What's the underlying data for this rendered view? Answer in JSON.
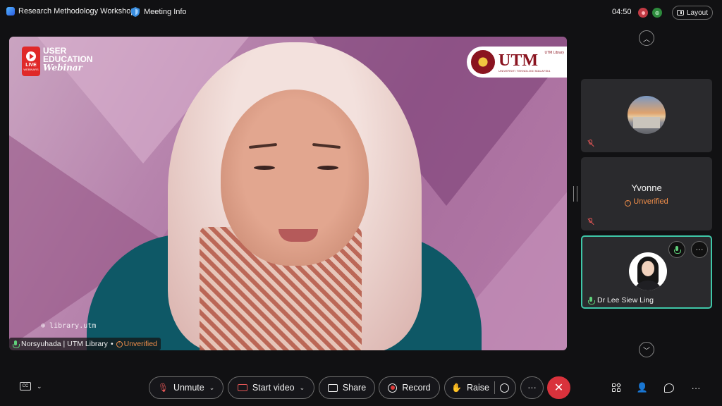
{
  "topbar": {
    "meeting_title": "Research Methodology Workshop",
    "meeting_info_label": "Meeting Info",
    "timer": "04:50",
    "layout_label": "Layout"
  },
  "stage": {
    "webinar_logo": {
      "live": "LIVE",
      "live_sub": "WEBINARS",
      "line1": "USER",
      "line2": "EDUCATION",
      "line3": "Webinar"
    },
    "utm_logo": {
      "text": "UTM",
      "subtext": "UNIVERSITI TEKNOLOGI MALAYSIA",
      "library": "UTM Library"
    },
    "url_text": "library.utm",
    "name_tag": {
      "name": "Norsyuhada | UTM Library",
      "separator": "•",
      "status": "Unverified"
    }
  },
  "participants": [
    {
      "name": "",
      "status": "",
      "mic": "muted",
      "avatar": "photo-building"
    },
    {
      "name": "Yvonne",
      "status": "Unverified",
      "mic": "muted",
      "avatar": "none"
    },
    {
      "name": "Dr Lee Siew Ling",
      "status": "",
      "mic": "active",
      "avatar": "portrait",
      "more_label": "···"
    }
  ],
  "controls": {
    "captions_label": "CC",
    "unmute": "Unmute",
    "start_video": "Start video",
    "share": "Share",
    "record": "Record",
    "raise": "Raise",
    "more": "···",
    "leave": "✕",
    "right_more": "···"
  },
  "colors": {
    "accent_active_tile": "#3fc7a8",
    "leave_red": "#d9323c",
    "unverified_orange": "#f08e4a",
    "mic_green": "#5fd07a"
  }
}
